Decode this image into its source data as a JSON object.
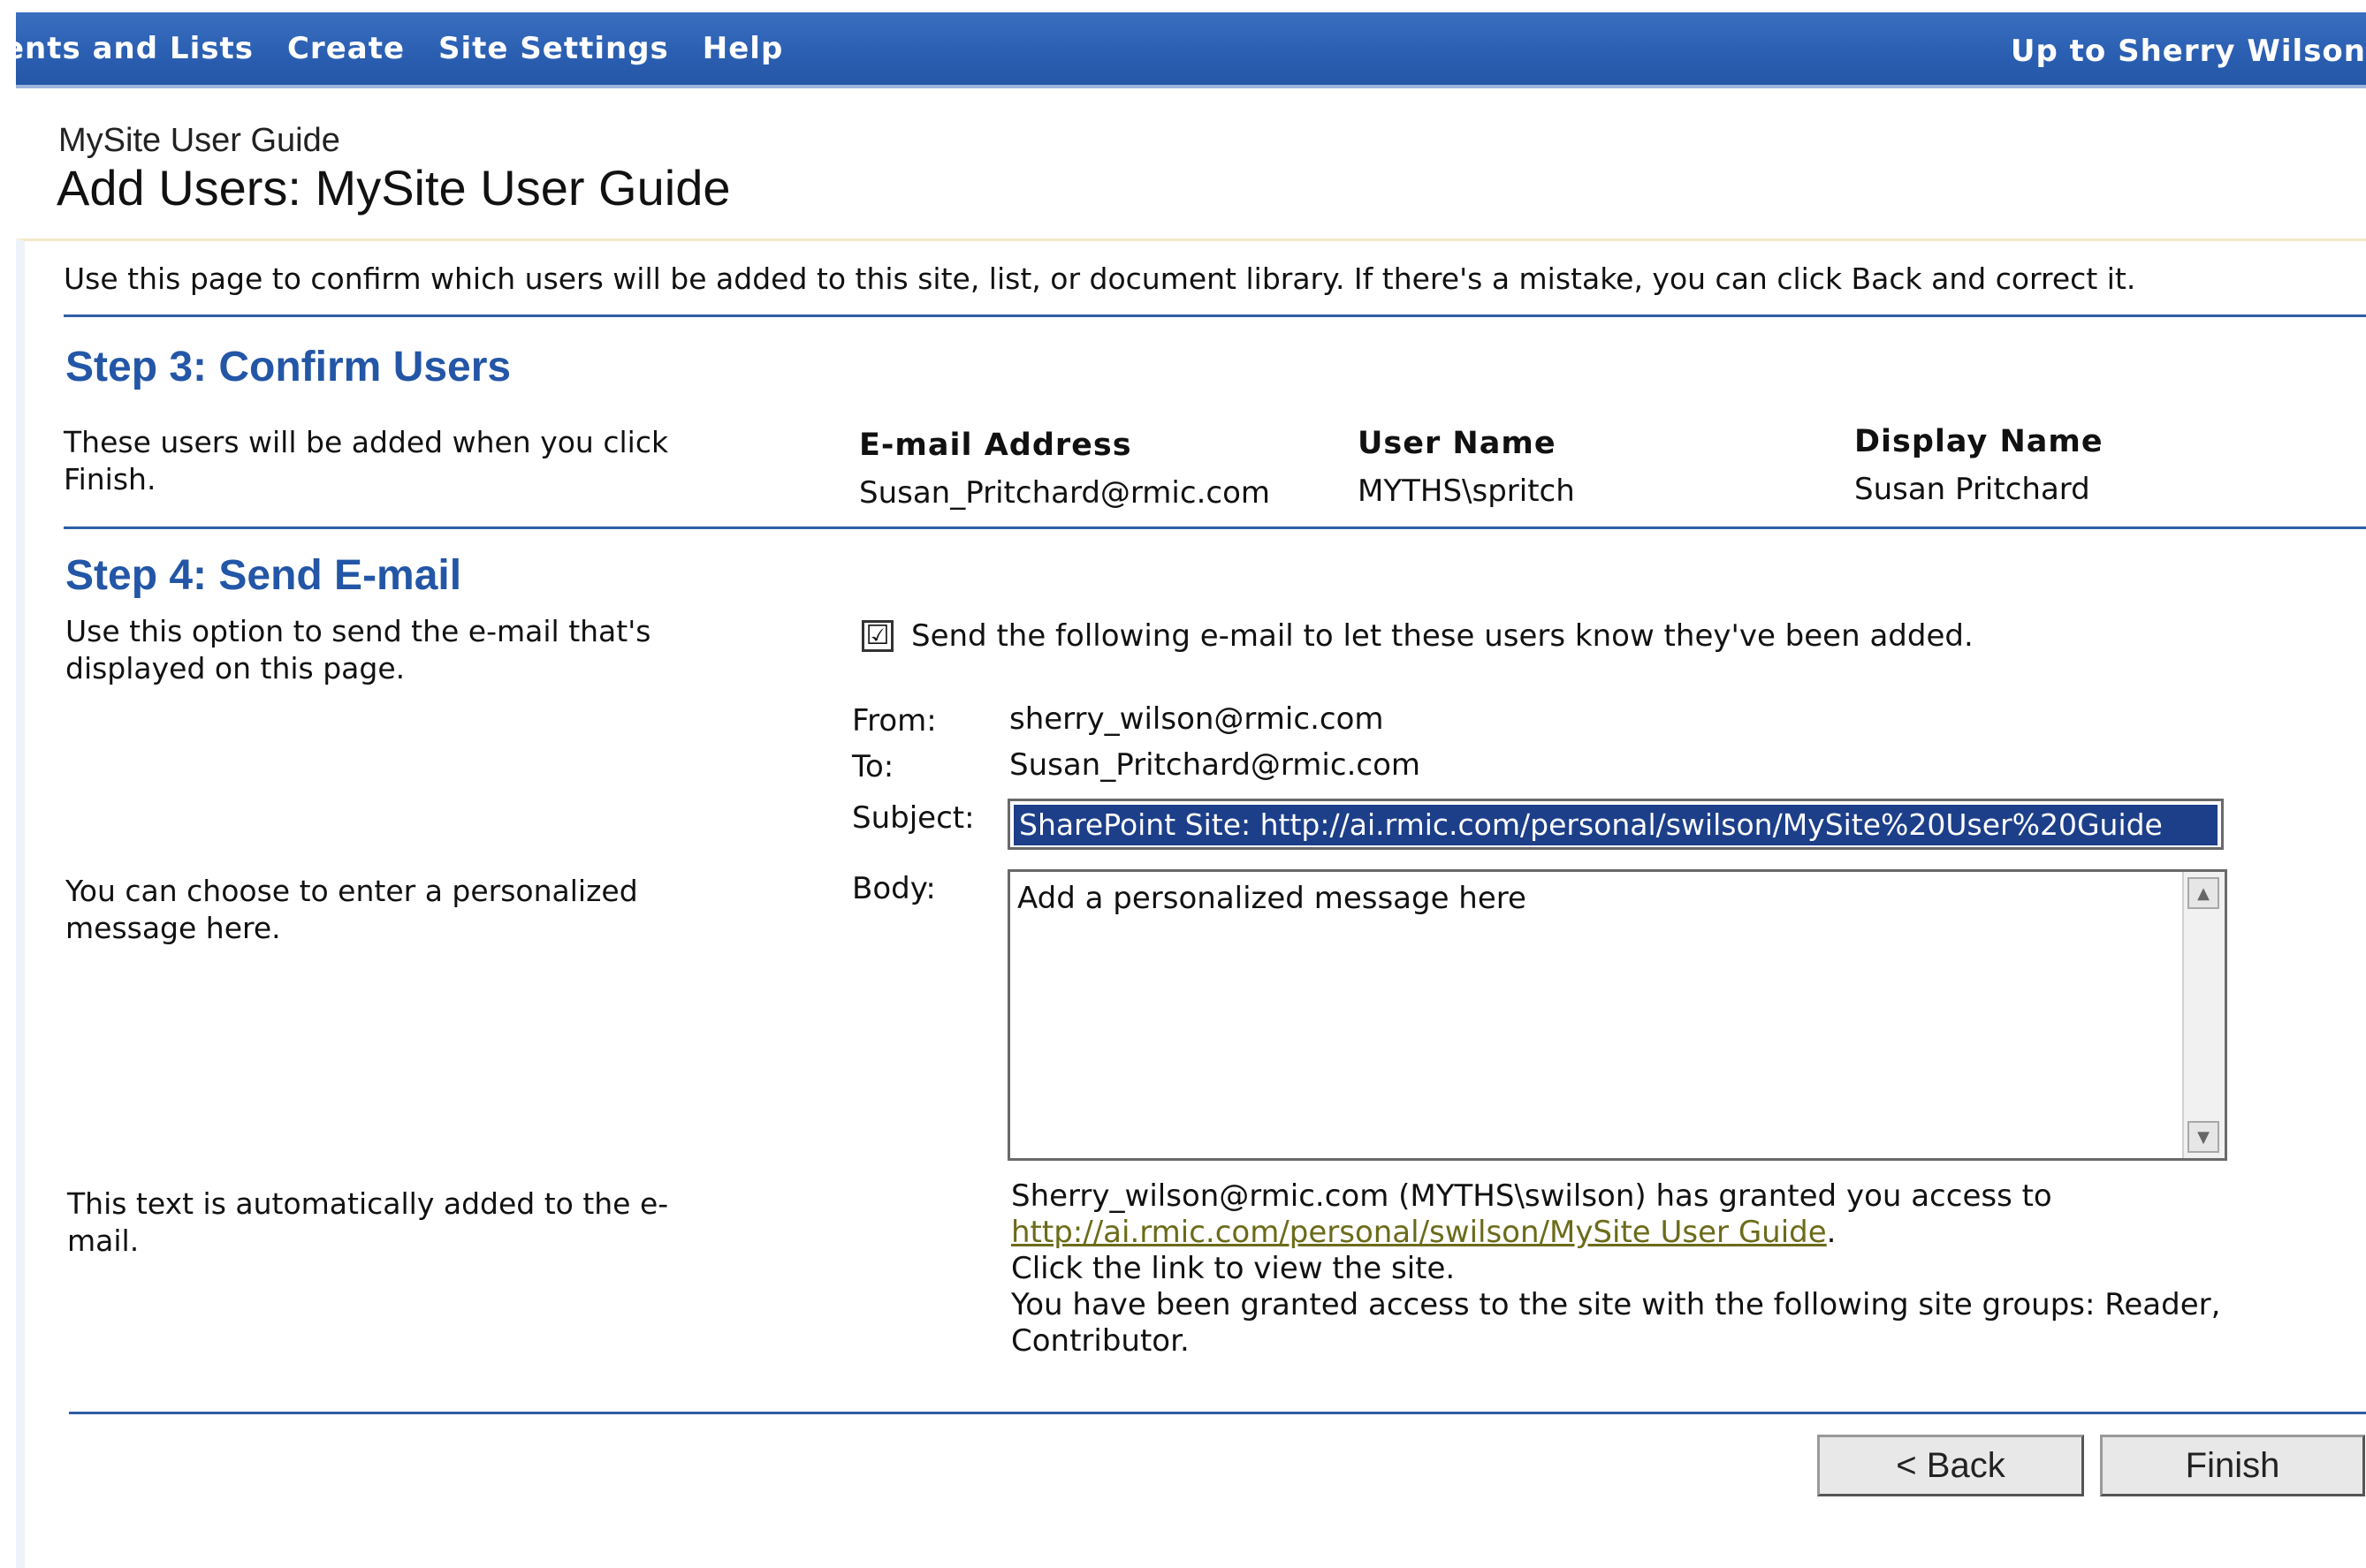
{
  "nav": {
    "items": [
      "ents and Lists",
      "Create",
      "Site Settings",
      "Help"
    ],
    "up_link": "Up to Sherry Wilson"
  },
  "header": {
    "site_name": "MySite User Guide",
    "title": "Add Users: MySite User Guide"
  },
  "intro": "Use this page to confirm which users will be added to this site, list, or document library. If there's a mistake, you can click Back and correct it.",
  "step3": {
    "title": "Step 3: Confirm Users",
    "description": "These users will be added when you click Finish.",
    "columns": [
      "E-mail Address",
      "User Name",
      "Display Name"
    ],
    "rows": [
      [
        "Susan_Pritchard@rmic.com",
        "MYTHS\\spritch",
        "Susan Pritchard"
      ]
    ]
  },
  "step4": {
    "title": "Step 4: Send E-mail",
    "description": "Use this option to send the e-mail that's displayed on this page.",
    "personal_desc": "You can choose to enter a personalized message here.",
    "auto_desc": "This text is automatically added to the e-mail.",
    "checkbox": {
      "checked": true,
      "mark": "☑",
      "label": "Send the following e-mail to let these users know they've been added."
    },
    "from_label": "From:",
    "from_value": "sherry_wilson@rmic.com",
    "to_label": "To:",
    "to_value": "Susan_Pritchard@rmic.com",
    "subject_label": "Subject:",
    "subject_value": "SharePoint Site: http://ai.rmic.com/personal/swilson/MySite%20User%20Guide",
    "body_label": "Body:",
    "body_value": "Add a personalized message here",
    "auto_text": {
      "line1": "Sherry_wilson@rmic.com (MYTHS\\swilson) has granted you access to",
      "link": "http://ai.rmic.com/personal/swilson/MySite User Guide",
      "line1_end": ".",
      "line2": "Click the link to view the site.",
      "line3": "You have been granted access to the site with the following site groups: Reader, Contributor."
    }
  },
  "buttons": {
    "back": "< Back",
    "finish": "Finish"
  },
  "icons": {
    "scroll_up": "▲",
    "scroll_down": "▼"
  },
  "colors": {
    "nav_bar": "#2b5fb2",
    "heading": "#2356a6",
    "rule": "#2f5ea7",
    "link": "#6b6b1a",
    "selection": "#1d3f8a"
  }
}
